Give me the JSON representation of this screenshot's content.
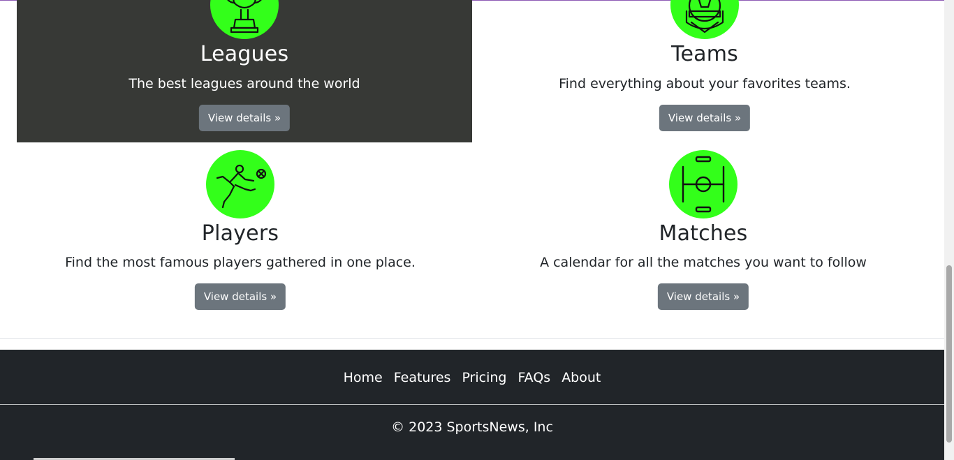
{
  "features": [
    {
      "title": "Leagues",
      "description": "The best leagues around the world",
      "button_label": "View details »",
      "icon": "trophy-icon"
    },
    {
      "title": "Teams",
      "description": "Find everything about your favorites teams.",
      "button_label": "View details »",
      "icon": "team-crest-icon"
    },
    {
      "title": "Players",
      "description": "Find the most famous players gathered in one place.",
      "button_label": "View details »",
      "icon": "football-player-icon"
    },
    {
      "title": "Matches",
      "description": "A calendar for all the matches you want to follow",
      "button_label": "View details »",
      "icon": "football-pitch-icon"
    }
  ],
  "footer": {
    "nav": [
      {
        "label": "Home"
      },
      {
        "label": "Features"
      },
      {
        "label": "Pricing"
      },
      {
        "label": "FAQs"
      },
      {
        "label": "About"
      }
    ],
    "copyright": "© 2023 SportsNews, Inc"
  },
  "colors": {
    "icon_circle": "#33ff1a",
    "highlight_card": "#373936",
    "button": "#6c757d",
    "footer": "#212529"
  }
}
